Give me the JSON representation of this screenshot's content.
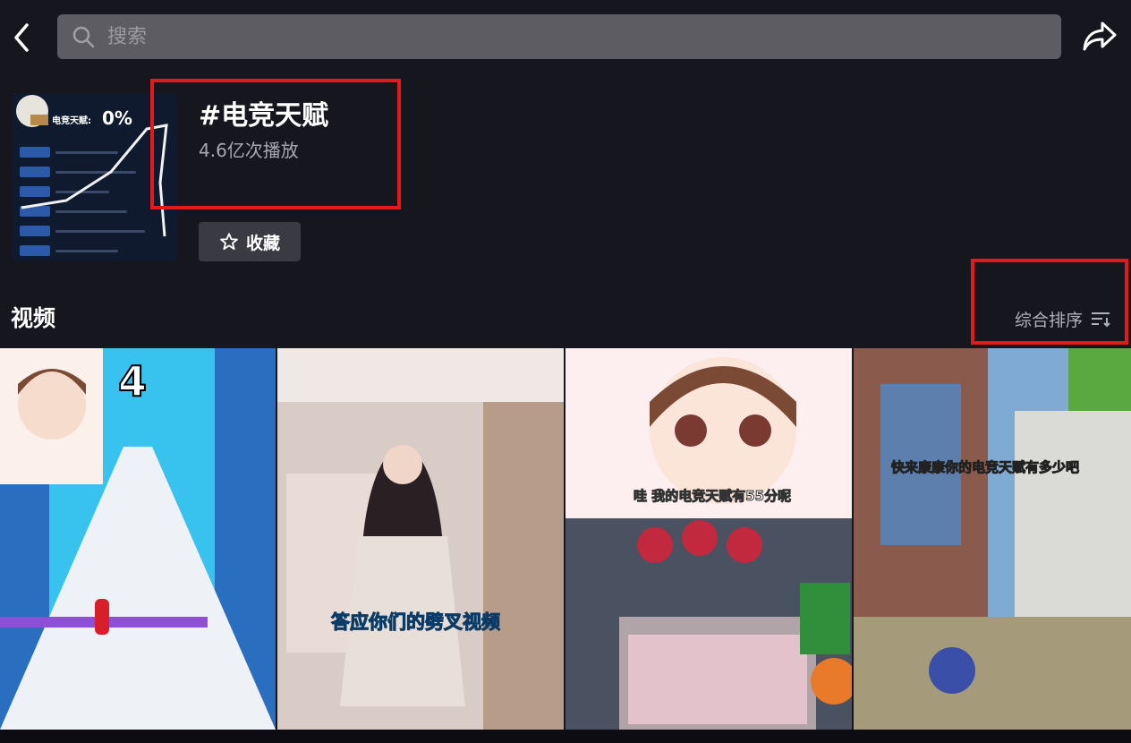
{
  "search": {
    "placeholder": "搜索"
  },
  "topic": {
    "title": "#电竞天赋",
    "plays": "4.6亿次播放",
    "collect_label": "收藏",
    "cover": {
      "percent": "0%",
      "label": "电竞天赋:"
    }
  },
  "section": {
    "title": "视频",
    "sort_label": "综合排序"
  },
  "videos": [
    {
      "caption": "4"
    },
    {
      "caption": "答应你们的劈叉视频"
    },
    {
      "caption": "哇 我的电竞天赋有55分呢"
    },
    {
      "caption": "快来康康你的电竞天赋有多少吧"
    }
  ],
  "colors": {
    "highlight": "#e41a1a",
    "background": "#16161f",
    "search_bg": "#5c5c62"
  },
  "icons": [
    "back-arrow-icon",
    "search-icon",
    "share-icon",
    "star-icon",
    "sort-icon"
  ]
}
